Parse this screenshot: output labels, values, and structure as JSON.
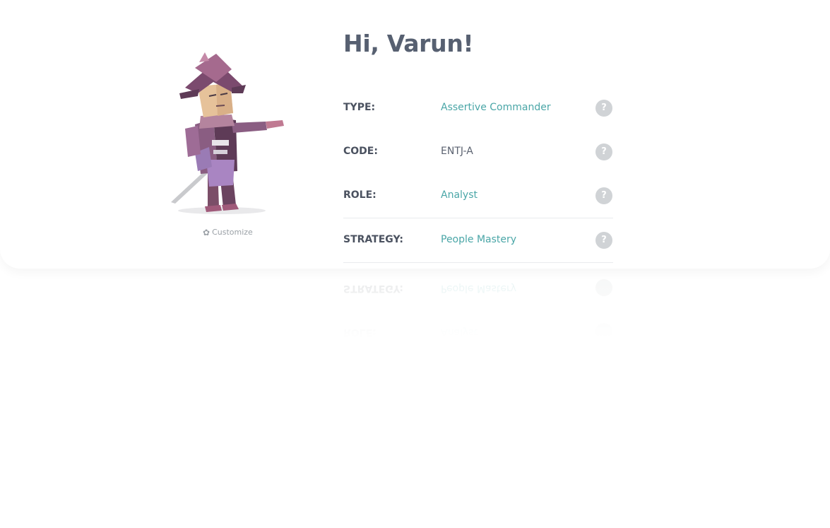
{
  "greeting": "Hi, Varun!",
  "avatar": {
    "customize_label": "Customize",
    "customize_icon": "gear-icon"
  },
  "profile": {
    "rows": [
      {
        "label": "TYPE:",
        "value": "Assertive Commander",
        "help": "?"
      },
      {
        "label": "CODE:",
        "value": "ENTJ-A",
        "help": "?"
      },
      {
        "label": "ROLE:",
        "value": "Analyst",
        "help": "?"
      },
      {
        "label": "STRATEGY:",
        "value": "People Mastery",
        "help": "?"
      }
    ]
  },
  "colors": {
    "accent": "#4aa6a7",
    "heading": "#576071",
    "label": "#4b5260",
    "help_badge": "#d0d3d6"
  }
}
